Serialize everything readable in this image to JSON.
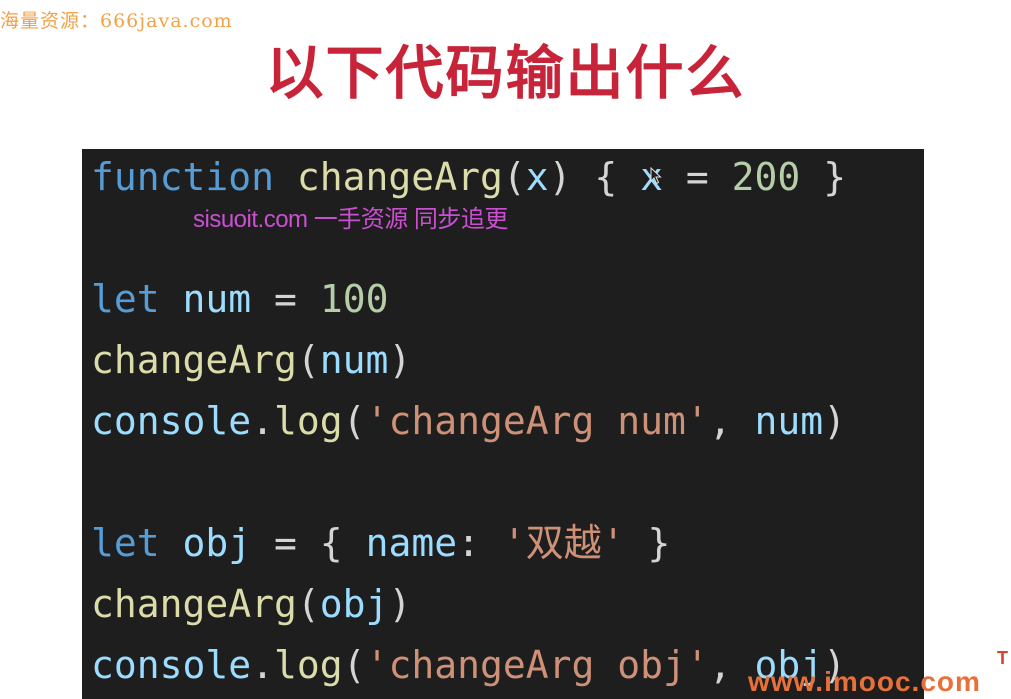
{
  "watermark_top": "海量资源：666java.com",
  "title": "以下代码输出什么",
  "overlay_watermark": "sisuoit.com 一手资源 同步追更",
  "code": {
    "line1": {
      "kw": "function",
      "fn": "changeArg",
      "p1": "(",
      "param": "x",
      "p2": ") {",
      "var": "x",
      "eq": " = ",
      "num": "200",
      "end": " }"
    },
    "line2": {
      "kw": "let",
      "var": "num",
      "eq": " = ",
      "num": "100"
    },
    "line3": {
      "fn": "changeArg",
      "p1": "(",
      "var": "num",
      "p2": ")"
    },
    "line4": {
      "obj": "console",
      "dot": ".",
      "fn": "log",
      "p1": "(",
      "str": "'changeArg num'",
      "comma": ", ",
      "var": "num",
      "p2": ")"
    },
    "line5": {
      "kw": "let",
      "var": "obj",
      "eq": " = { ",
      "prop": "name",
      "colon": ": ",
      "str": "'双越'",
      "end": " }"
    },
    "line6": {
      "fn": "changeArg",
      "p1": "(",
      "var": "obj",
      "p2": ")"
    },
    "line7": {
      "obj": "console",
      "dot": ".",
      "fn": "log",
      "p1": "(",
      "str": "'changeArg obj'",
      "comma": ", ",
      "var": "obj",
      "p2": ")"
    }
  },
  "watermark_bottom": "www.imooc.com",
  "corner_mark": "T",
  "colors": {
    "title": "#c7243a",
    "code_background": "#1e1e1e",
    "keyword": "#569cd6",
    "function": "#dcdcaa",
    "variable": "#9cdcfe",
    "number": "#b5cea8",
    "string": "#ce9178"
  },
  "icons": [
    "mouse-cursor-icon"
  ]
}
